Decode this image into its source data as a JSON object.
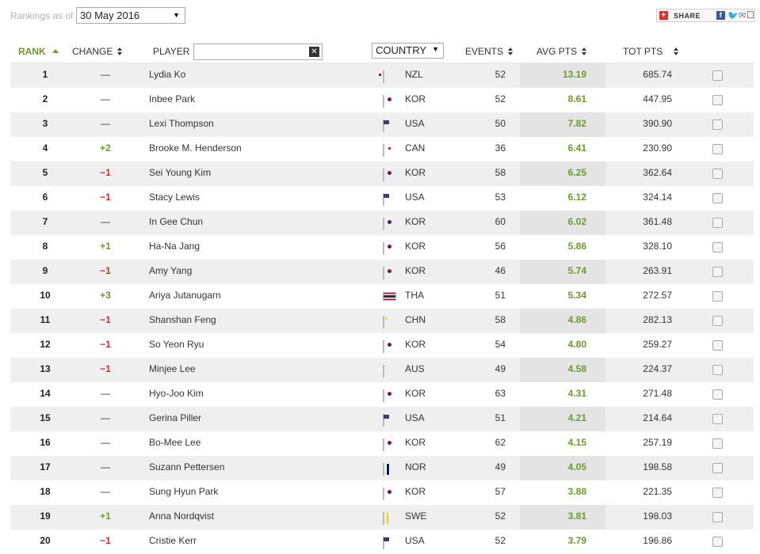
{
  "top": {
    "asof_label": "Rankings as of",
    "date_value": "30 May 2016",
    "share_label": "SHARE"
  },
  "header": {
    "rank": "RANK",
    "change": "CHANGE",
    "player": "PLAYER",
    "player_filter_value": "",
    "country": "COUNTRY",
    "events": "EVENTS",
    "avg_pts": "AVG PTS",
    "tot_pts": "TOT PTS"
  },
  "rows": [
    {
      "rank": "1",
      "change": "—",
      "dir": "same",
      "player": "Lydia Ko",
      "flag": "nzl",
      "country": "NZL",
      "events": "52",
      "avg": "13.19",
      "tot": "685.74"
    },
    {
      "rank": "2",
      "change": "—",
      "dir": "same",
      "player": "Inbee Park",
      "flag": "kor",
      "country": "KOR",
      "events": "52",
      "avg": "8.61",
      "tot": "447.95"
    },
    {
      "rank": "3",
      "change": "—",
      "dir": "same",
      "player": "Lexi Thompson",
      "flag": "usa",
      "country": "USA",
      "events": "50",
      "avg": "7.82",
      "tot": "390.90"
    },
    {
      "rank": "4",
      "change": "+2",
      "dir": "up",
      "player": "Brooke M. Henderson",
      "flag": "can",
      "country": "CAN",
      "events": "36",
      "avg": "6.41",
      "tot": "230.90"
    },
    {
      "rank": "5",
      "change": "−1",
      "dir": "down",
      "player": "Sei Young Kim",
      "flag": "kor",
      "country": "KOR",
      "events": "58",
      "avg": "6.25",
      "tot": "362.64"
    },
    {
      "rank": "6",
      "change": "−1",
      "dir": "down",
      "player": "Stacy Lewis",
      "flag": "usa",
      "country": "USA",
      "events": "53",
      "avg": "6.12",
      "tot": "324.14"
    },
    {
      "rank": "7",
      "change": "—",
      "dir": "same",
      "player": "In Gee Chun",
      "flag": "kor",
      "country": "KOR",
      "events": "60",
      "avg": "6.02",
      "tot": "361.48"
    },
    {
      "rank": "8",
      "change": "+1",
      "dir": "up",
      "player": "Ha-Na Jang",
      "flag": "kor",
      "country": "KOR",
      "events": "56",
      "avg": "5.86",
      "tot": "328.10"
    },
    {
      "rank": "9",
      "change": "−1",
      "dir": "down",
      "player": "Amy Yang",
      "flag": "kor",
      "country": "KOR",
      "events": "46",
      "avg": "5.74",
      "tot": "263.91"
    },
    {
      "rank": "10",
      "change": "+3",
      "dir": "up",
      "player": "Ariya Jutanugarn",
      "flag": "tha",
      "country": "THA",
      "events": "51",
      "avg": "5.34",
      "tot": "272.57"
    },
    {
      "rank": "11",
      "change": "−1",
      "dir": "down",
      "player": "Shanshan Feng",
      "flag": "chn",
      "country": "CHN",
      "events": "58",
      "avg": "4.86",
      "tot": "282.13"
    },
    {
      "rank": "12",
      "change": "−1",
      "dir": "down",
      "player": "So Yeon Ryu",
      "flag": "kor",
      "country": "KOR",
      "events": "54",
      "avg": "4.80",
      "tot": "259.27"
    },
    {
      "rank": "13",
      "change": "−1",
      "dir": "down",
      "player": "Minjee Lee",
      "flag": "aus",
      "country": "AUS",
      "events": "49",
      "avg": "4.58",
      "tot": "224.37"
    },
    {
      "rank": "14",
      "change": "—",
      "dir": "same",
      "player": "Hyo-Joo Kim",
      "flag": "kor",
      "country": "KOR",
      "events": "63",
      "avg": "4.31",
      "tot": "271.48"
    },
    {
      "rank": "15",
      "change": "—",
      "dir": "same",
      "player": "Gerina Piller",
      "flag": "usa",
      "country": "USA",
      "events": "51",
      "avg": "4.21",
      "tot": "214.64"
    },
    {
      "rank": "16",
      "change": "—",
      "dir": "same",
      "player": "Bo-Mee Lee",
      "flag": "kor",
      "country": "KOR",
      "events": "62",
      "avg": "4.15",
      "tot": "257.19"
    },
    {
      "rank": "17",
      "change": "—",
      "dir": "same",
      "player": "Suzann Pettersen",
      "flag": "nor",
      "country": "NOR",
      "events": "49",
      "avg": "4.05",
      "tot": "198.58"
    },
    {
      "rank": "18",
      "change": "—",
      "dir": "same",
      "player": "Sung Hyun Park",
      "flag": "kor",
      "country": "KOR",
      "events": "57",
      "avg": "3.88",
      "tot": "221.35"
    },
    {
      "rank": "19",
      "change": "+1",
      "dir": "up",
      "player": "Anna Nordqvist",
      "flag": "swe",
      "country": "SWE",
      "events": "52",
      "avg": "3.81",
      "tot": "198.03"
    },
    {
      "rank": "20",
      "change": "−1",
      "dir": "down",
      "player": "Cristie Kerr",
      "flag": "usa",
      "country": "USA",
      "events": "52",
      "avg": "3.79",
      "tot": "196.86"
    }
  ],
  "colors": {
    "accent_green": "#6a9b2a",
    "down_red": "#d9282f",
    "row_stripe": "#efefef"
  }
}
